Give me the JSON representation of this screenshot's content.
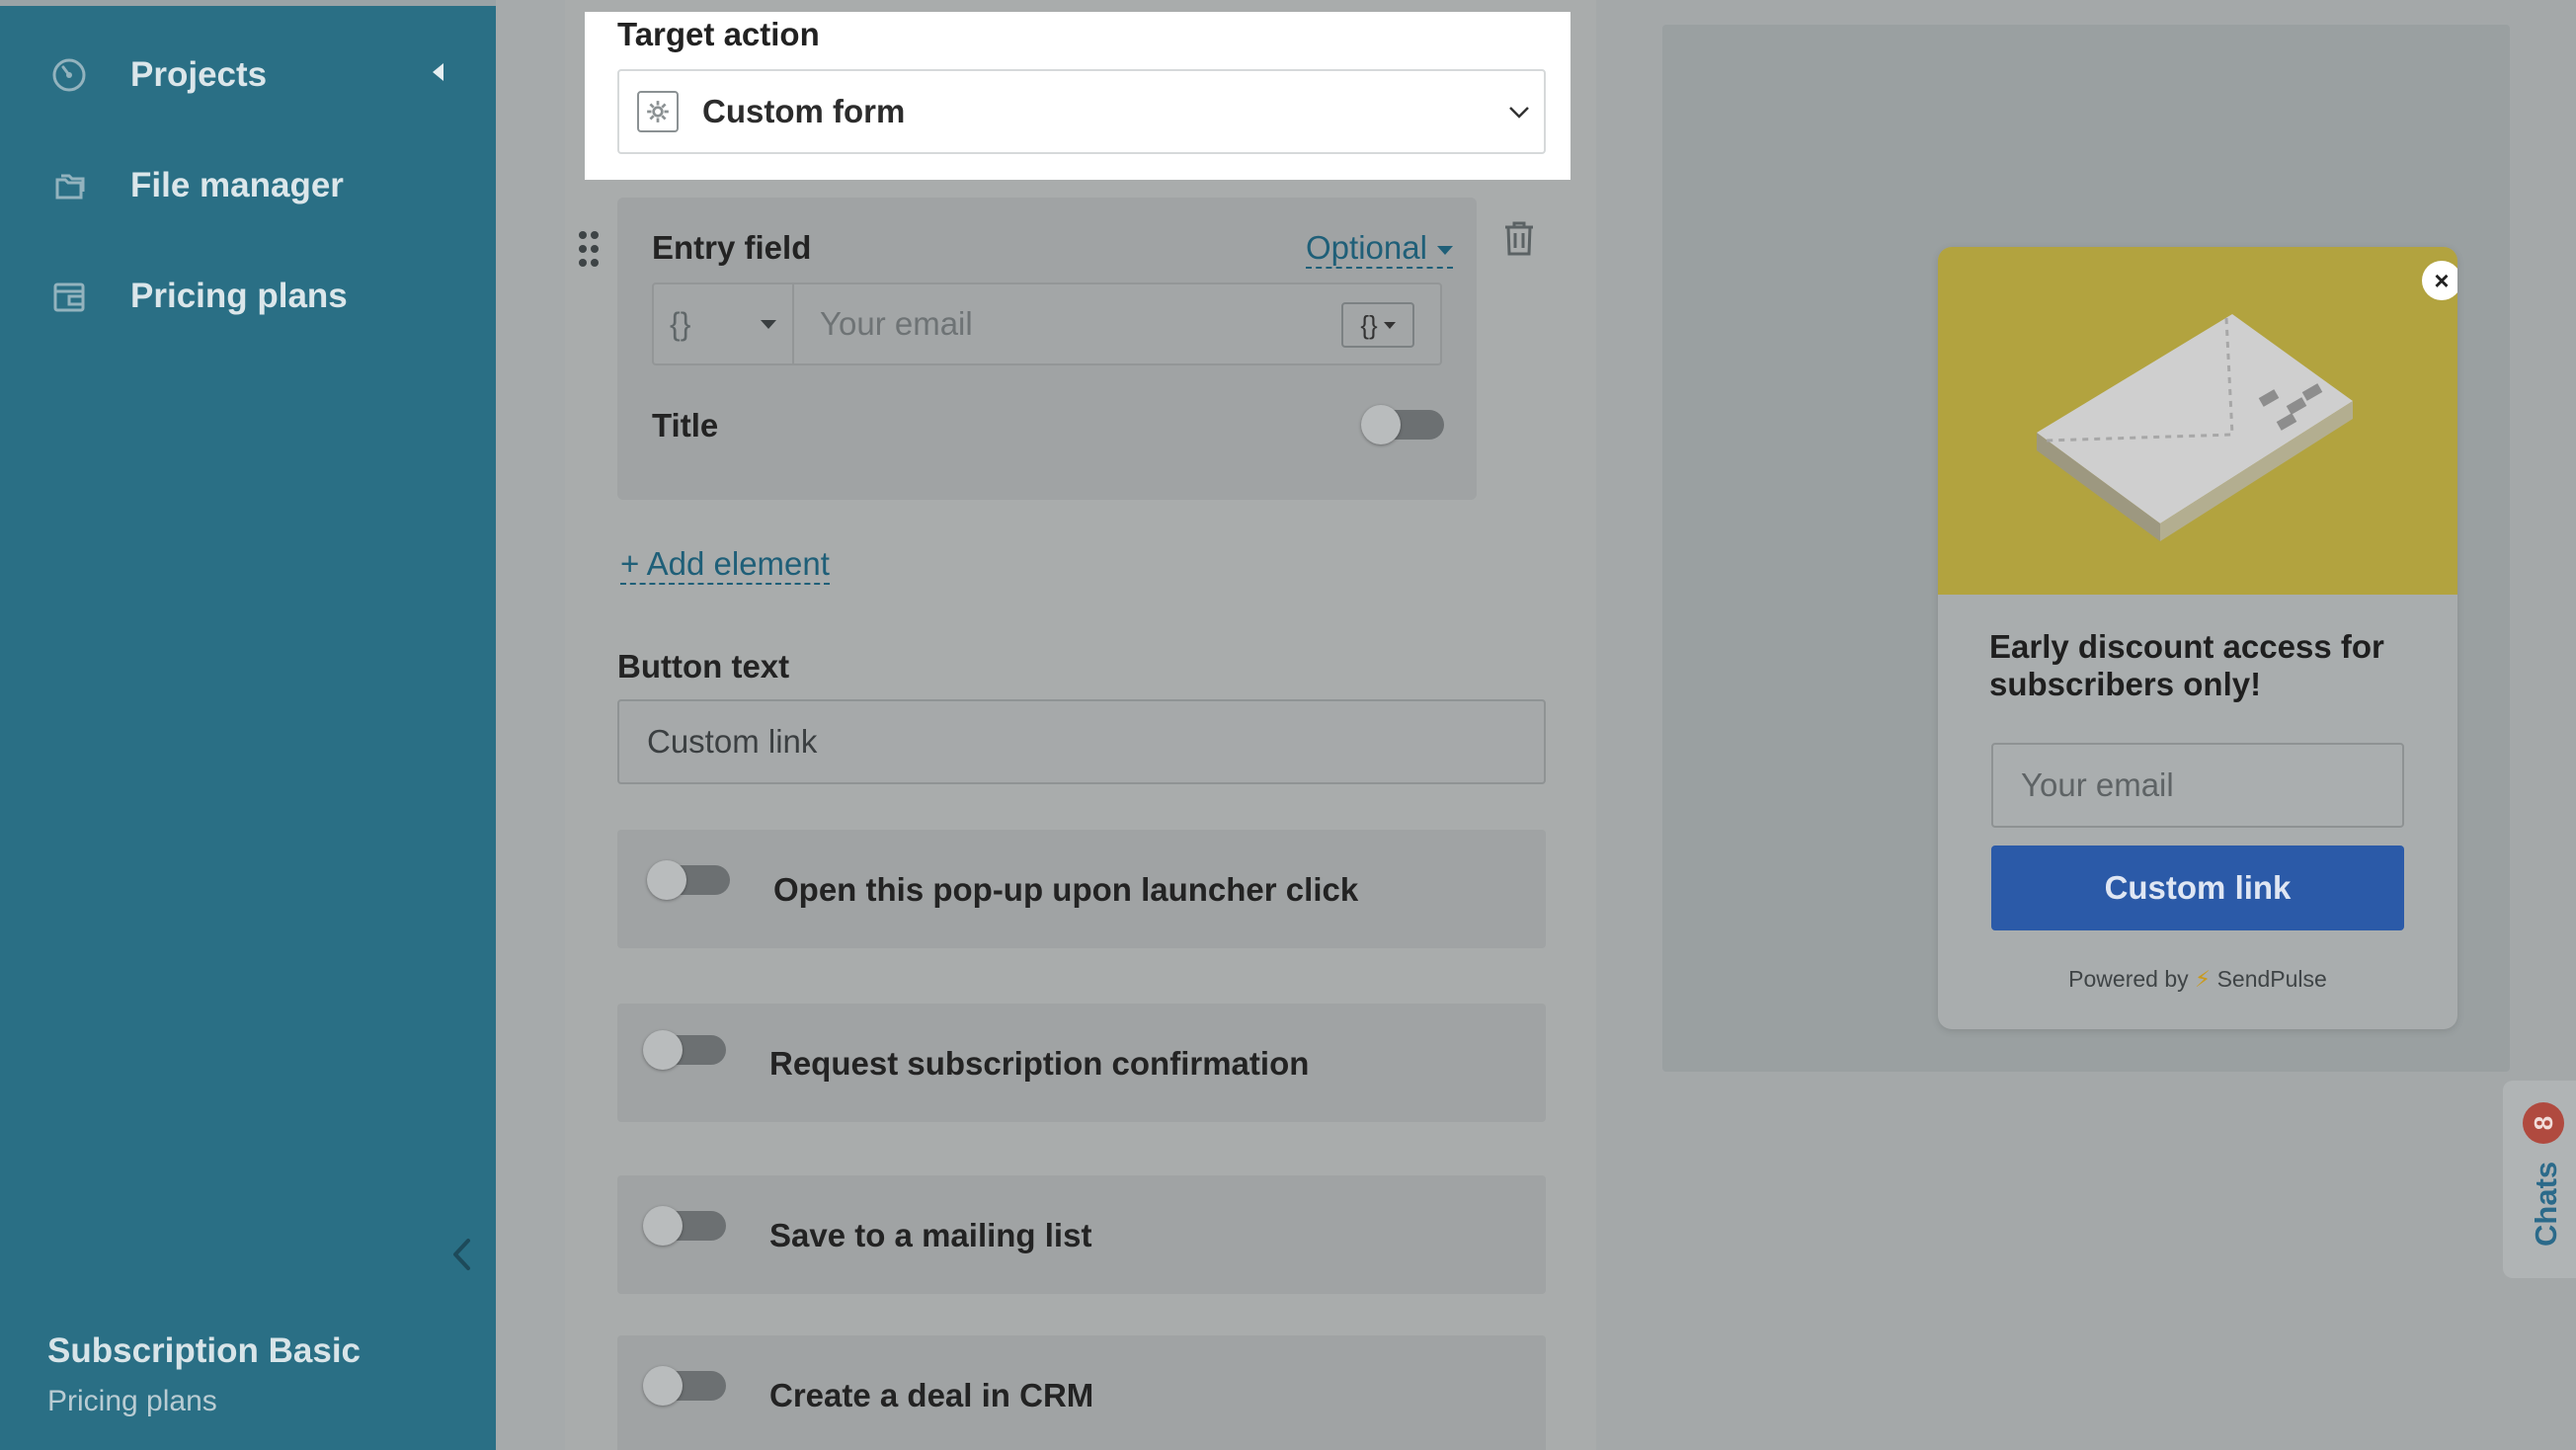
{
  "sidebar": {
    "items": [
      {
        "label": "Projects",
        "icon": "projects-icon"
      },
      {
        "label": "File manager",
        "icon": "folder-icon"
      },
      {
        "label": "Pricing plans",
        "icon": "wallet-icon"
      }
    ],
    "plan_name": "Subscription Basic",
    "plan_sub": "Pricing plans"
  },
  "form": {
    "target_action_label": "Target action",
    "target_action_value": "Custom form",
    "entry_field_label": "Entry field",
    "optional_label": "Optional",
    "vars_glyph": "{}",
    "entry_placeholder": "Your email",
    "var_button": "{}",
    "title_label": "Title",
    "add_element": "+ Add element",
    "button_text_label": "Button text",
    "button_text_value": "Custom link",
    "options": [
      {
        "label": "Open this pop-up upon launcher click"
      },
      {
        "label": "Request subscription confirmation"
      },
      {
        "label": "Save to a mailing list"
      },
      {
        "label": "Create a deal in CRM"
      }
    ]
  },
  "preview": {
    "close_glyph": "×",
    "headline": "Early discount access for subscribers only!",
    "email_placeholder": "Your email",
    "cta": "Custom link",
    "powered_prefix": "Powered by",
    "bolt": "⚡",
    "powered_brand": "SendPulse"
  },
  "chats": {
    "badge": "8",
    "label": "Chats"
  },
  "colors": {
    "sidebar": "#2a6f85",
    "accent_link": "#1f5f78",
    "cta": "#2b5aa8",
    "popup_image": "#b2a33f",
    "badge": "#b04a3f"
  }
}
